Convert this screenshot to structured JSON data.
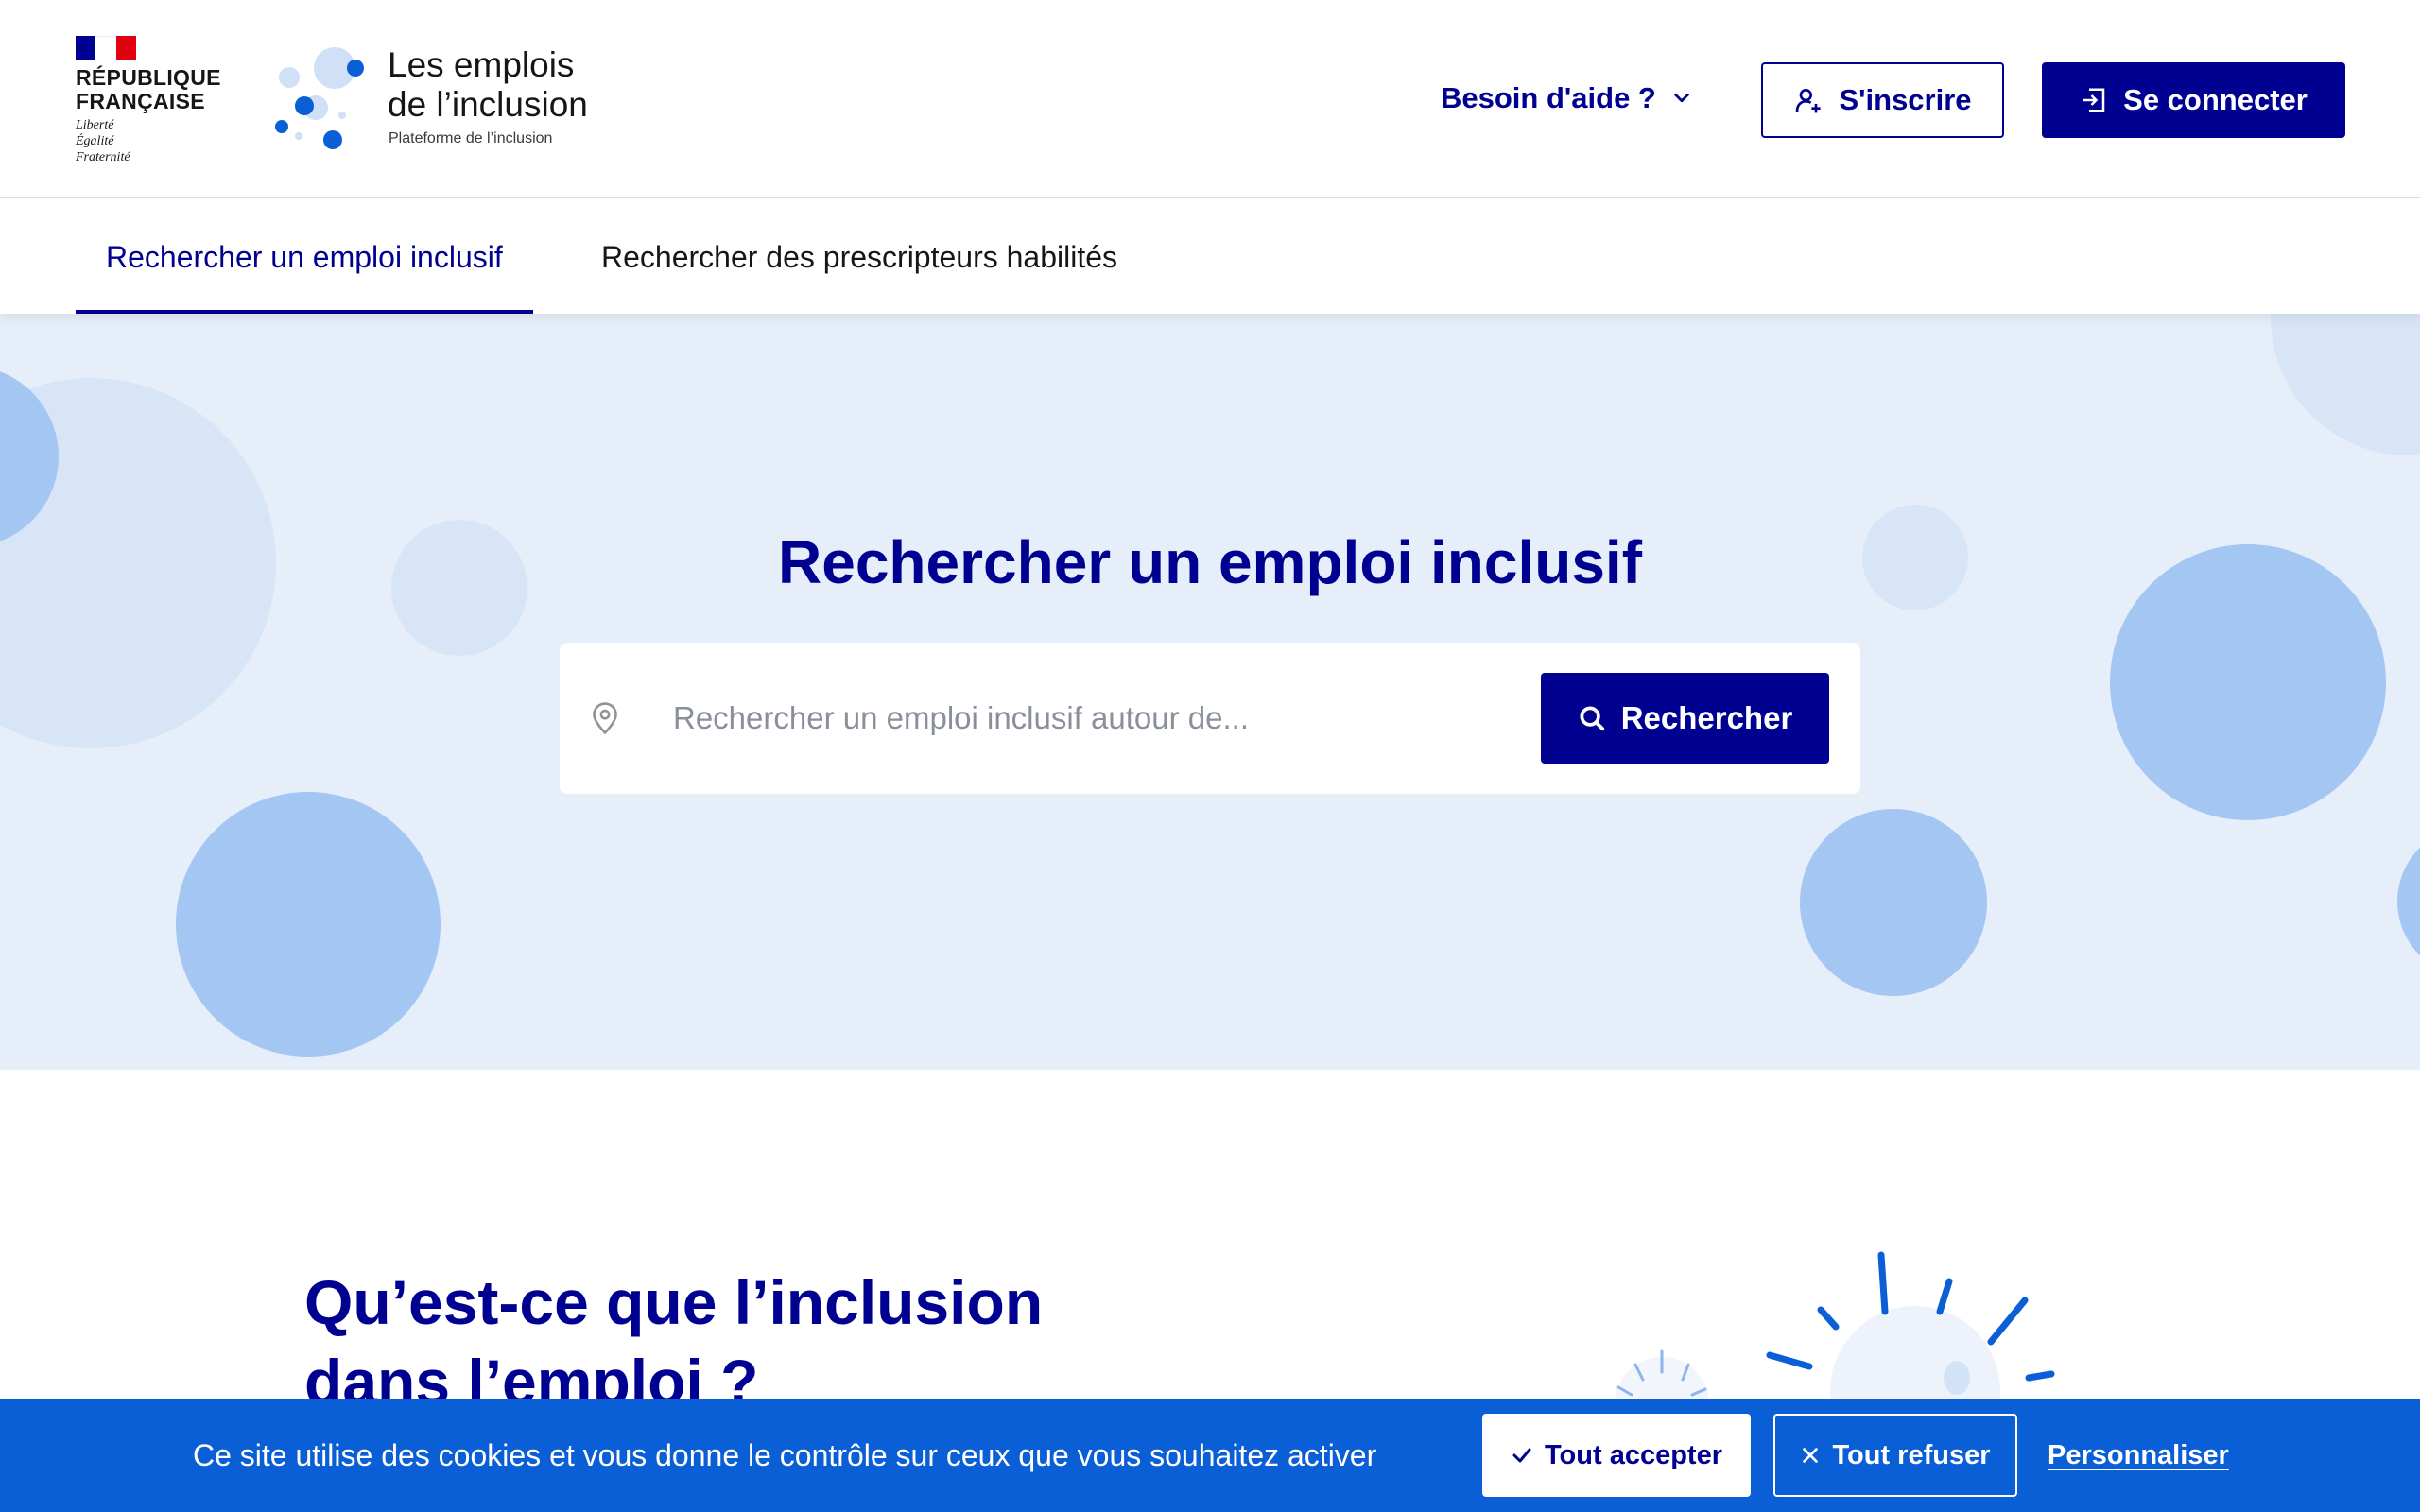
{
  "header": {
    "republic_name": "RÉPUBLIQUE\nFRANÇAISE",
    "motto": "Liberté\nÉgalité\nFraternité",
    "brand_title": "Les emplois\nde l’inclusion",
    "brand_subtitle": "Plateforme de l’inclusion",
    "help_label": "Besoin d'aide ?",
    "signup_label": "S'inscrire",
    "login_label": "Se connecter"
  },
  "nav": {
    "tabs": [
      {
        "label": "Rechercher un emploi inclusif",
        "active": true
      },
      {
        "label": "Rechercher des prescripteurs habilités",
        "active": false
      }
    ]
  },
  "hero": {
    "title": "Rechercher un emploi inclusif",
    "search_placeholder": "Rechercher un emploi inclusif autour de...",
    "search_value": "",
    "search_button": "Rechercher"
  },
  "section": {
    "title": "Qu’est-ce que l’inclusion\ndans l’emploi ?"
  },
  "cookie": {
    "text": "Ce site utilise des cookies et vous donne le contrôle sur ceux que vous souhaitez activer",
    "accept": "Tout accepter",
    "refuse": "Tout refuser",
    "customize": "Personnaliser"
  },
  "colors": {
    "primary": "#000091",
    "hero_bg": "#e6eefa",
    "bubble": "#a3c6f3",
    "bubble_light": "#d8e5f7",
    "cookie_bg": "#0b5fd6",
    "flag_red": "#e1000f"
  },
  "icons": {
    "help": "chevron-down-icon",
    "signup": "user-add-icon",
    "login": "login-icon",
    "location": "map-pin-icon",
    "search": "search-icon",
    "accept": "check-icon",
    "refuse": "close-icon"
  }
}
